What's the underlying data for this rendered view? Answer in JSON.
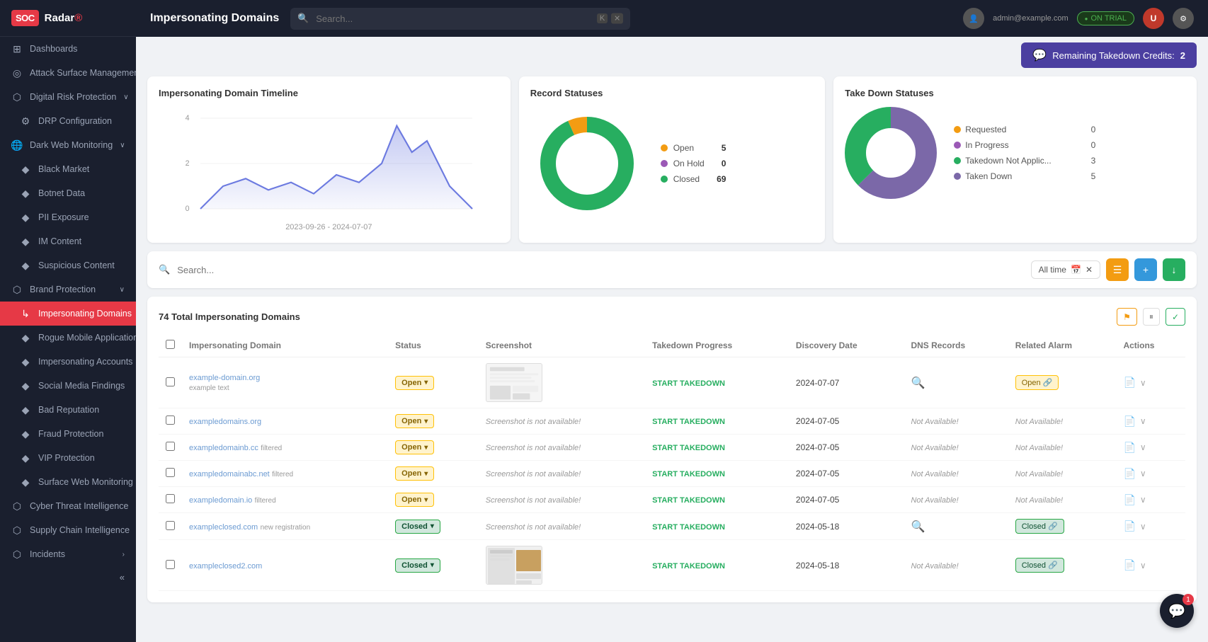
{
  "sidebar": {
    "logo": "SOCRadar",
    "items": [
      {
        "id": "dashboards",
        "label": "Dashboards",
        "icon": "⊞",
        "hasChevron": false
      },
      {
        "id": "attack-surface",
        "label": "Attack Surface Management",
        "icon": "◎",
        "hasChevron": true
      },
      {
        "id": "digital-risk",
        "label": "Digital Risk Protection",
        "icon": "⬡",
        "hasChevron": true
      },
      {
        "id": "drp-config",
        "label": "DRP Configuration",
        "icon": "",
        "indent": true,
        "hasChevron": false
      },
      {
        "id": "dark-web",
        "label": "Dark Web Monitoring",
        "icon": "🌐",
        "hasChevron": true
      },
      {
        "id": "black-market",
        "label": "Black Market",
        "icon": "◆",
        "indent": true
      },
      {
        "id": "botnet-data",
        "label": "Botnet Data",
        "icon": "◆",
        "indent": true
      },
      {
        "id": "pii-exposure",
        "label": "PII Exposure",
        "icon": "◆",
        "indent": true
      },
      {
        "id": "im-content",
        "label": "IM Content",
        "icon": "◆",
        "indent": true
      },
      {
        "id": "suspicious-content",
        "label": "Suspicious Content",
        "icon": "◆",
        "indent": true
      },
      {
        "id": "brand-protection",
        "label": "Brand Protection",
        "icon": "⬡",
        "hasChevron": true
      },
      {
        "id": "impersonating-domains",
        "label": "Impersonating Domains",
        "icon": "⤷",
        "indent": true,
        "active": true
      },
      {
        "id": "rogue-mobile",
        "label": "Rogue Mobile Applications",
        "icon": "◆",
        "indent": true
      },
      {
        "id": "impersonating-accounts",
        "label": "Impersonating Accounts",
        "icon": "◆",
        "indent": true
      },
      {
        "id": "social-media",
        "label": "Social Media Findings",
        "icon": "◆",
        "indent": true
      },
      {
        "id": "bad-reputation",
        "label": "Bad Reputation",
        "icon": "◆",
        "indent": true
      },
      {
        "id": "fraud-protection",
        "label": "Fraud Protection",
        "icon": "◆",
        "indent": true
      },
      {
        "id": "vip-protection",
        "label": "VIP Protection",
        "icon": "◆",
        "indent": true
      },
      {
        "id": "surface-web",
        "label": "Surface Web Monitoring",
        "icon": "◆",
        "indent": true
      },
      {
        "id": "cyber-threat",
        "label": "Cyber Threat Intelligence",
        "icon": "⬡",
        "hasChevron": true
      },
      {
        "id": "supply-chain",
        "label": "Supply Chain Intelligence",
        "icon": "⬡",
        "hasChevron": true
      },
      {
        "id": "incidents",
        "label": "Incidents",
        "icon": "⬡",
        "hasChevron": true
      }
    ]
  },
  "header": {
    "title": "Impersonating Domains",
    "search_placeholder": "Search...",
    "trial_label": "ON TRIAL",
    "credits_label": "Remaining Takedown Credits:",
    "credits_count": "2"
  },
  "charts": {
    "timeline": {
      "title": "Impersonating Domain Timeline",
      "date_range": "2023-09-26 - 2024-07-07",
      "y_labels": [
        "4",
        "2",
        "0"
      ]
    },
    "record_statuses": {
      "title": "Record Statuses",
      "segments": [
        {
          "label": "Open",
          "color": "#f39c12",
          "count": 5,
          "percentage": 6.8
        },
        {
          "label": "On Hold",
          "color": "#9b59b6",
          "count": 0,
          "percentage": 0
        },
        {
          "label": "Closed",
          "color": "#27ae60",
          "count": 69,
          "percentage": 93.2
        }
      ]
    },
    "takedown_statuses": {
      "title": "Take Down Statuses",
      "segments": [
        {
          "label": "Requested",
          "color": "#f39c12",
          "count": 0,
          "percentage": 0
        },
        {
          "label": "In Progress",
          "color": "#9b59b6",
          "count": 0,
          "percentage": 0
        },
        {
          "label": "Takedown Not Applic...",
          "color": "#27ae60",
          "count": 3,
          "percentage": 37.5
        },
        {
          "label": "Taken Down",
          "color": "#7b68a8",
          "count": 5,
          "percentage": 62.5
        }
      ]
    }
  },
  "filter": {
    "search_placeholder": "Search...",
    "date_filter_label": "All time",
    "export_btn": "↓",
    "plus_btn": "+",
    "filter_btn": "☰"
  },
  "table": {
    "title": "74 Total Impersonating Domains",
    "columns": [
      "Impersonating Domain",
      "Status",
      "Screenshot",
      "Takedown Progress",
      "Discovery Date",
      "DNS Records",
      "Related Alarm",
      "Actions"
    ],
    "rows": [
      {
        "domain": "example-domain.org",
        "sub": "example text",
        "status": "Open",
        "screenshot": "available",
        "takedown": "START TAKEDOWN",
        "discovery": "2024-07-07",
        "dns": "search",
        "alarm": "Open",
        "hasAlarmLink": true
      },
      {
        "domain": "exampledomains.org",
        "sub": "",
        "status": "Open",
        "screenshot": "not_available",
        "takedown": "START TAKEDOWN",
        "discovery": "2024-07-05",
        "dns": "na",
        "alarm": "na",
        "hasAlarmLink": false
      },
      {
        "domain": "exampledomainb.cc",
        "sub": "filtered",
        "status": "Open",
        "screenshot": "not_available",
        "takedown": "START TAKEDOWN",
        "discovery": "2024-07-05",
        "dns": "na",
        "alarm": "na",
        "hasAlarmLink": false
      },
      {
        "domain": "exampledomainabc.net",
        "sub": "filtered",
        "status": "Open",
        "screenshot": "not_available",
        "takedown": "START TAKEDOWN",
        "discovery": "2024-07-05",
        "dns": "na",
        "alarm": "na",
        "hasAlarmLink": false
      },
      {
        "domain": "exampledomain.io",
        "sub": "filtered",
        "status": "Open",
        "screenshot": "not_available",
        "takedown": "START TAKEDOWN",
        "discovery": "2024-07-05",
        "dns": "na",
        "alarm": "na",
        "hasAlarmLink": false
      },
      {
        "domain": "exampleclosed.com",
        "sub": "new registration",
        "status": "Closed",
        "screenshot": "not_available",
        "takedown": "START TAKEDOWN",
        "discovery": "2024-05-18",
        "dns": "search",
        "alarm": "Closed",
        "hasAlarmLink": true
      },
      {
        "domain": "exampleclosed2.com",
        "sub": "",
        "status": "Closed",
        "screenshot": "available2",
        "takedown": "START TAKEDOWN",
        "discovery": "2024-05-18",
        "dns": "na",
        "alarm": "Closed",
        "hasAlarmLink": true
      }
    ],
    "not_available_text": "Screenshot is not available!",
    "not_available_dns": "Not Available!",
    "not_available_alarm": "Not Available!"
  },
  "fab": {
    "badge": "1"
  }
}
